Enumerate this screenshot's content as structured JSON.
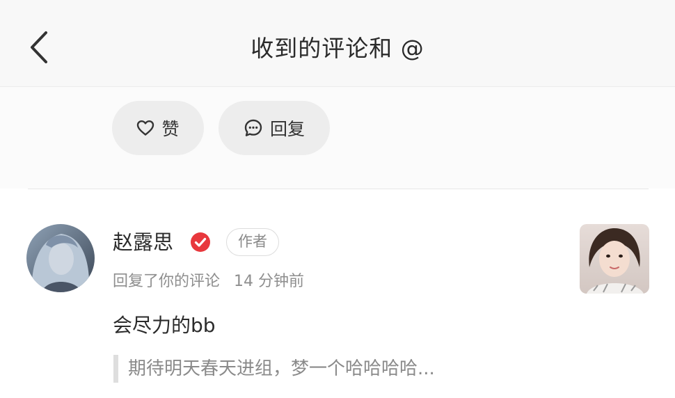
{
  "header": {
    "title": "收到的评论和 @"
  },
  "actions": {
    "like_label": "赞",
    "reply_label": "回复",
    "like_icon": "heart-outline-icon",
    "reply_icon": "chat-bubble-icon"
  },
  "notification": {
    "user_name": "赵露思",
    "verified_icon": "verified-check-icon",
    "verified_color": "#e8383d",
    "badge": "作者",
    "action": "回复了你的评论",
    "time": "14 分钟前",
    "comment": "会尽力的bb",
    "quoted_comment": "期待明天春天进组，梦一个哈哈哈哈..."
  },
  "colors": {
    "background": "#ffffff",
    "header_bg": "#f8f8f8",
    "pill_bg": "#ededed",
    "secondary_text": "#8e8e8e"
  }
}
